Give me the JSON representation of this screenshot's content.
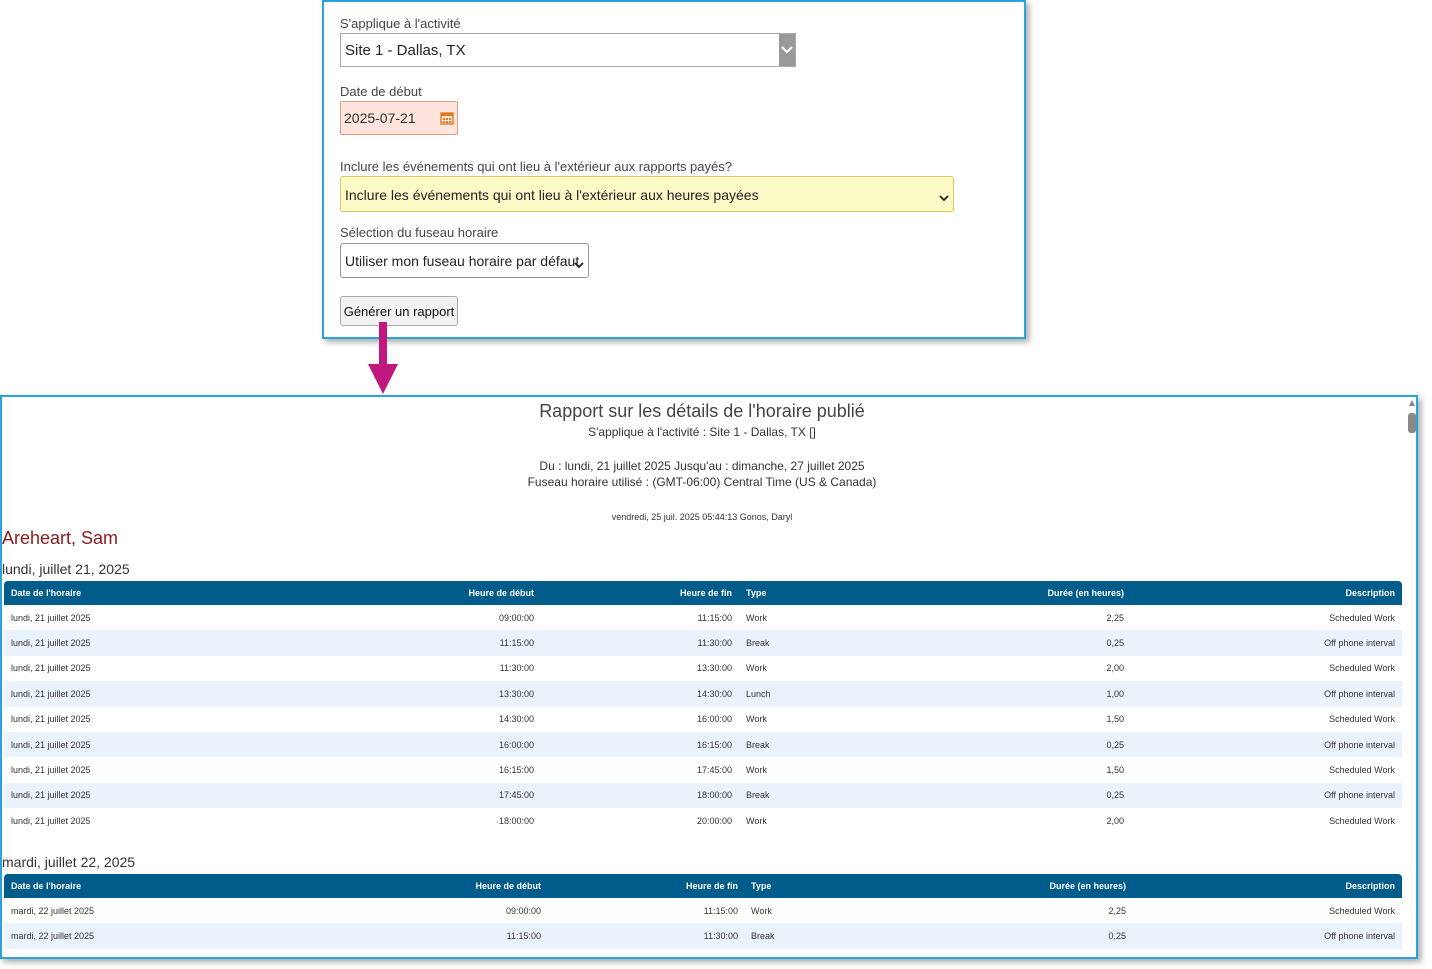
{
  "form": {
    "activity_label": "S'applique à l'activité",
    "activity_value": "Site 1 - Dallas, TX",
    "start_date_label": "Date de début",
    "start_date_value": "2025-07-21",
    "outside_label": "Inclure les événements qui ont lieu à l'extérieur aux rapports payés?",
    "outside_value": "Inclure les événements qui ont lieu à l'extérieur aux heures payées",
    "timezone_label": "Sélection du fuseau horaire",
    "timezone_value": "Utiliser mon fuseau horaire par défaut",
    "generate_button": "Générer un rapport"
  },
  "colors": {
    "accent_border": "#29a3d9",
    "arrow": "#c0187e",
    "table_header": "#005c8a",
    "employee_name": "#8b1a1a"
  },
  "report": {
    "title": "Rapport sur les détails de l'horaire publié",
    "activity_line": "S'applique à l'activité : Site 1 - Dallas, TX []",
    "range_line": "Du : lundi, 21 juillet 2025 Jusqu'au : dimanche, 27 juillet 2025",
    "timezone_line": "Fuseau horaire utilisé : (GMT-06:00) Central Time (US & Canada)",
    "generated_line": "vendredi, 25 juil. 2025 05:44:13  Gonos, Daryl",
    "employee": "Areheart, Sam",
    "columns": {
      "date": "Date de l'horaire",
      "start": "Heure de début",
      "end": "Heure de fin",
      "type": "Type",
      "duration": "Durée (en heures)",
      "description": "Description"
    },
    "days": [
      {
        "title": "lundi, juillet 21, 2025",
        "rows": [
          {
            "date": "lundi, 21 juillet 2025",
            "start": "09:00:00",
            "end": "11:15:00",
            "type": "Work",
            "duration": "2,25",
            "description": "Scheduled Work"
          },
          {
            "date": "lundi, 21 juillet 2025",
            "start": "11:15:00",
            "end": "11:30:00",
            "type": "Break",
            "duration": "0,25",
            "description": "Off phone interval"
          },
          {
            "date": "lundi, 21 juillet 2025",
            "start": "11:30:00",
            "end": "13:30:00",
            "type": "Work",
            "duration": "2,00",
            "description": "Scheduled Work"
          },
          {
            "date": "lundi, 21 juillet 2025",
            "start": "13:30:00",
            "end": "14:30:00",
            "type": "Lunch",
            "duration": "1,00",
            "description": "Off phone interval"
          },
          {
            "date": "lundi, 21 juillet 2025",
            "start": "14:30:00",
            "end": "16:00:00",
            "type": "Work",
            "duration": "1,50",
            "description": "Scheduled Work"
          },
          {
            "date": "lundi, 21 juillet 2025",
            "start": "16:00:00",
            "end": "16:15:00",
            "type": "Break",
            "duration": "0,25",
            "description": "Off phone interval"
          },
          {
            "date": "lundi, 21 juillet 2025",
            "start": "16:15:00",
            "end": "17:45:00",
            "type": "Work",
            "duration": "1,50",
            "description": "Scheduled Work"
          },
          {
            "date": "lundi, 21 juillet 2025",
            "start": "17:45:00",
            "end": "18:00:00",
            "type": "Break",
            "duration": "0,25",
            "description": "Off phone interval"
          },
          {
            "date": "lundi, 21 juillet 2025",
            "start": "18:00:00",
            "end": "20:00:00",
            "type": "Work",
            "duration": "2,00",
            "description": "Scheduled Work"
          }
        ]
      },
      {
        "title": "mardi, juillet 22, 2025",
        "rows": [
          {
            "date": "mardi, 22 juillet 2025",
            "start": "09:00:00",
            "end": "11:15:00",
            "type": "Work",
            "duration": "2,25",
            "description": "Scheduled Work"
          },
          {
            "date": "mardi, 22 juillet 2025",
            "start": "11:15:00",
            "end": "11:30:00",
            "type": "Break",
            "duration": "0,25",
            "description": "Off phone interval"
          }
        ]
      }
    ]
  }
}
